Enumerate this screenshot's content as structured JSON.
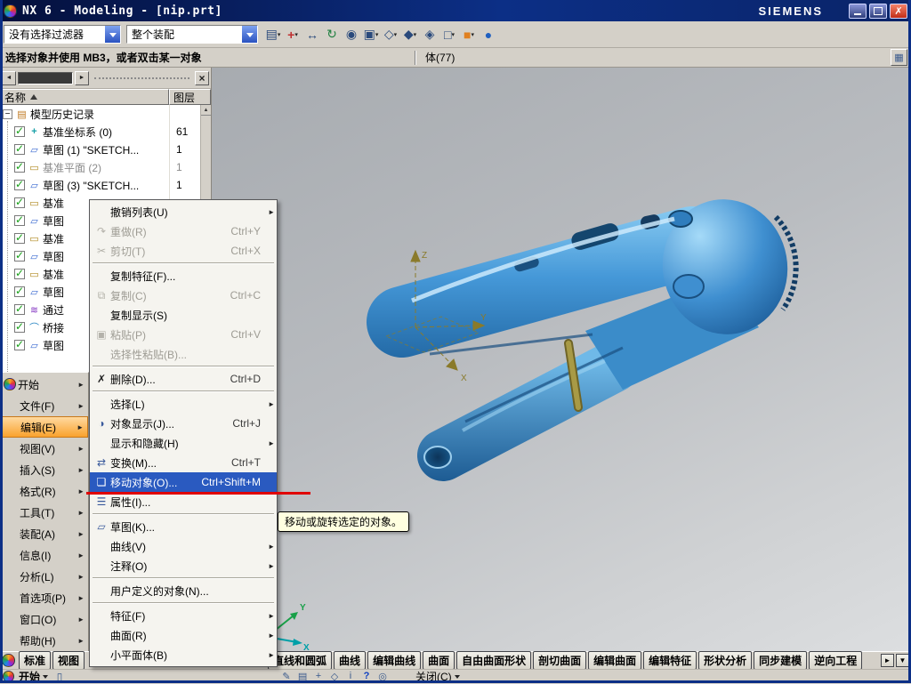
{
  "window": {
    "title": "NX 6 - Modeling - [nip.prt]",
    "brand": "SIEMENS"
  },
  "toolbar": {
    "filter_value": "没有选择过滤器",
    "scope_value": "整个装配",
    "icons": [
      {
        "name": "layers-icon",
        "dd": true
      },
      {
        "name": "snap-point-icon",
        "dd": true
      },
      {
        "name": "pan-icon"
      },
      {
        "name": "rotate-icon"
      },
      {
        "name": "zoom-icon"
      },
      {
        "name": "fit-view-icon",
        "dd": true
      },
      {
        "name": "orient-view-icon",
        "dd": true
      },
      {
        "name": "shaded-view-icon",
        "dd": true
      },
      {
        "name": "wireframe-view-icon"
      },
      {
        "name": "rect-select-icon",
        "dd": true
      },
      {
        "name": "shaded-cube-icon",
        "dd": true
      },
      {
        "name": "sphere-icon"
      }
    ]
  },
  "prompt_bar": {
    "message": "选择对象并使用 MB3，或者双击某一对象",
    "status": "体(77)"
  },
  "navigator": {
    "columns": {
      "name": "名称",
      "layer": "图层"
    },
    "rows": [
      {
        "label": "模型历史记录",
        "icon": "history-icon",
        "root": true,
        "expander": true,
        "layer": ""
      },
      {
        "label": "基准坐标系 (0)",
        "icon": "datum-csys-icon",
        "checked": true,
        "layer": "61"
      },
      {
        "label": "草图 (1) \"SKETCH...",
        "icon": "sketch-icon",
        "checked": true,
        "layer": "1"
      },
      {
        "label": "基准平面 (2)",
        "icon": "datum-plane-icon",
        "checked": true,
        "layer": "1",
        "dim": true
      },
      {
        "label": "草图 (3) \"SKETCH...",
        "icon": "sketch-icon",
        "checked": true,
        "layer": "1"
      },
      {
        "label": "基准",
        "icon": "datum-plane-icon",
        "checked": true,
        "layer": ""
      },
      {
        "label": "草图",
        "icon": "sketch-icon",
        "checked": true,
        "layer": ""
      },
      {
        "label": "基准",
        "icon": "datum-plane-icon",
        "checked": true,
        "layer": ""
      },
      {
        "label": "草图",
        "icon": "sketch-icon",
        "checked": true,
        "layer": ""
      },
      {
        "label": "基准",
        "icon": "datum-plane-icon",
        "checked": true,
        "layer": ""
      },
      {
        "label": "草图",
        "icon": "sketch-icon",
        "checked": true,
        "layer": ""
      },
      {
        "label": "通过",
        "icon": "through-curves-icon",
        "checked": true,
        "layer": ""
      },
      {
        "label": "桥接",
        "icon": "bridge-icon",
        "checked": true,
        "layer": ""
      },
      {
        "label": "草图",
        "icon": "sketch-icon",
        "checked": true,
        "layer": ""
      }
    ]
  },
  "menu_sidebar": {
    "items": [
      {
        "label": "开始",
        "icon": "nx-logo",
        "submenu": true
      },
      {
        "label": "文件(F)",
        "submenu": true
      },
      {
        "label": "编辑(E)",
        "submenu": true,
        "active": true
      },
      {
        "label": "视图(V)",
        "submenu": true
      },
      {
        "label": "插入(S)",
        "submenu": true
      },
      {
        "label": "格式(R)",
        "submenu": true
      },
      {
        "label": "工具(T)",
        "submenu": true
      },
      {
        "label": "装配(A)",
        "submenu": true
      },
      {
        "label": "信息(I)",
        "submenu": true
      },
      {
        "label": "分析(L)",
        "submenu": true
      },
      {
        "label": "首选项(P)",
        "submenu": true
      },
      {
        "label": "窗口(O)",
        "submenu": true
      },
      {
        "label": "帮助(H)",
        "submenu": true
      }
    ]
  },
  "context_menu": {
    "items": [
      {
        "label": "撤销列表(U)",
        "submenu": true
      },
      {
        "label": "重做(R)",
        "shortcut": "Ctrl+Y",
        "icon": "redo-icon",
        "disabled": true
      },
      {
        "label": "剪切(T)",
        "shortcut": "Ctrl+X",
        "icon": "cut-icon",
        "disabled": true,
        "sep_after": true
      },
      {
        "label": "复制特征(F)..."
      },
      {
        "label": "复制(C)",
        "shortcut": "Ctrl+C",
        "icon": "copy-icon",
        "disabled": true
      },
      {
        "label": "复制显示(S)"
      },
      {
        "label": "粘贴(P)",
        "shortcut": "Ctrl+V",
        "icon": "paste-icon",
        "disabled": true
      },
      {
        "label": "选择性粘贴(B)...",
        "disabled": true,
        "sep_after": true
      },
      {
        "label": "删除(D)...",
        "shortcut": "Ctrl+D",
        "icon": "delete-icon",
        "sep_after": true
      },
      {
        "label": "选择(L)",
        "submenu": true
      },
      {
        "label": "对象显示(J)...",
        "shortcut": "Ctrl+J",
        "icon": "object-display-icon"
      },
      {
        "label": "显示和隐藏(H)",
        "submenu": true
      },
      {
        "label": "变换(M)...",
        "shortcut": "Ctrl+T",
        "icon": "transform-icon"
      },
      {
        "label": "移动对象(O)...",
        "shortcut": "Ctrl+Shift+M",
        "icon": "move-object-icon",
        "highlighted": true
      },
      {
        "label": "属性(I)...",
        "icon": "properties-icon",
        "sep_after": true
      },
      {
        "label": "草图(K)...",
        "icon": "sketch-cmd-icon"
      },
      {
        "label": "曲线(V)",
        "submenu": true
      },
      {
        "label": "注释(O)",
        "submenu": true,
        "sep_after": true
      },
      {
        "label": "用户定义的对象(N)...",
        "sep_after": true
      },
      {
        "label": "特征(F)",
        "submenu": true
      },
      {
        "label": "曲面(R)",
        "submenu": true
      },
      {
        "label": "小平面体(B)",
        "submenu": true
      }
    ]
  },
  "tooltip": {
    "text": "移动或旋转选定的对象。"
  },
  "bottom_tabs": {
    "left": [
      {
        "label": "标准"
      },
      {
        "label": "视图"
      }
    ],
    "tools": [
      {
        "label": "直线和圆弧"
      },
      {
        "label": "曲线"
      },
      {
        "label": "编辑曲线"
      },
      {
        "label": "曲面"
      },
      {
        "label": "自由曲面形状"
      },
      {
        "label": "剖切曲面"
      },
      {
        "label": "编辑曲面"
      },
      {
        "label": "编辑特征"
      },
      {
        "label": "形状分析"
      },
      {
        "label": "同步建模"
      },
      {
        "label": "逆向工程"
      }
    ]
  },
  "bottom_bar": {
    "start_label": "开始",
    "close_label": "关闭(C)",
    "icons": [
      {
        "name": "pencil-icon"
      },
      {
        "name": "layer-icon"
      },
      {
        "name": "wcs-icon"
      },
      {
        "name": "orient-icon"
      },
      {
        "name": "info-icon"
      },
      {
        "name": "help-icon"
      },
      {
        "name": "find-icon"
      }
    ]
  },
  "colors": {
    "highlight": "#2a5ac0",
    "annotation_line": "#e00000",
    "active_menu": "#f9a22e",
    "model_blue": "#3f8fd0"
  }
}
